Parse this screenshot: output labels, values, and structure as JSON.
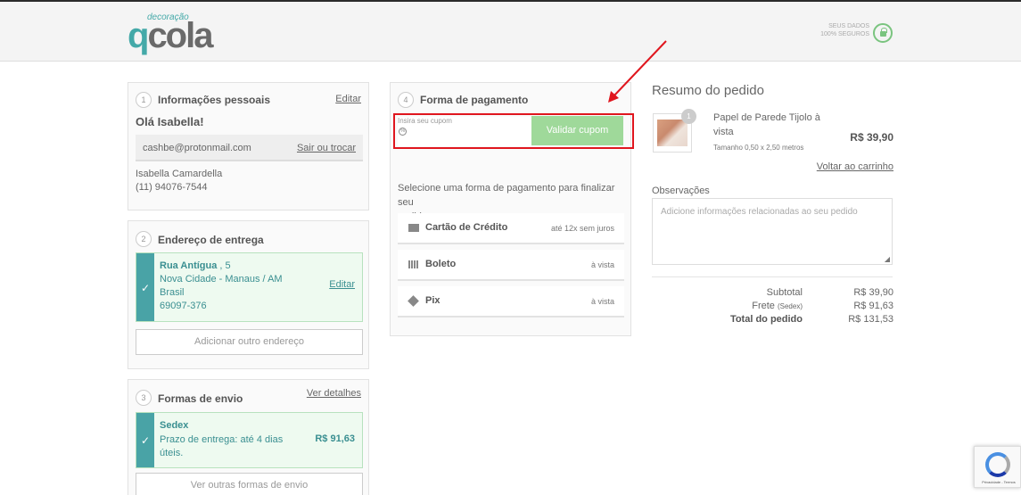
{
  "header": {
    "logo_small": "decoração",
    "logo_q": "q",
    "logo_rest": "cola",
    "secure_line1": "SEUS DADOS",
    "secure_line2": "100% SEGUROS"
  },
  "personal": {
    "step": "1",
    "title": "Informações pessoais",
    "edit": "Editar",
    "greeting": "Olá Isabella!",
    "email": "cashbe@protonmail.com",
    "logout": "Sair ou trocar",
    "name": "Isabella Camardella",
    "phone": "(11) 94076-7544"
  },
  "address": {
    "step": "2",
    "title": "Endereço de entrega",
    "street": "Rua Antígua",
    "number": " , 5",
    "city": "Nova Cidade - Manaus / AM",
    "country": "Brasil",
    "zip": "69097-376",
    "edit": "Editar",
    "add_button": "Adicionar outro endereço"
  },
  "shipping": {
    "step": "3",
    "title": "Formas de envio",
    "details": "Ver detalhes",
    "method": "Sedex",
    "deadline_line1": "Prazo de entrega: até 4 dias",
    "deadline_line2": "úteis.",
    "price": "R$ 91,63",
    "other_button": "Ver outras formas de envio"
  },
  "payment": {
    "step": "4",
    "title": "Forma de pagamento",
    "coupon_placeholder": "Insira seu cupom",
    "coupon_button": "Validar cupom",
    "instructions_line1": "Selecione uma forma de pagamento para finalizar seu",
    "instructions_line2": "pedido:",
    "methods": [
      {
        "label": "Cartão de Crédito",
        "note": "até 12x sem juros"
      },
      {
        "label": "Boleto",
        "note": "à vista"
      },
      {
        "label": "Pix",
        "note": "à vista"
      }
    ]
  },
  "summary": {
    "title": "Resumo do pedido",
    "qty": "1",
    "product_line1": "Papel de Parede Tijolo à",
    "product_line2": "vista",
    "product_size": "Tamanho 0,50 x 2,50 metros",
    "product_price": "R$ 39,90",
    "back_to_cart": "Voltar ao carrinho",
    "notes_label": "Observações",
    "notes_placeholder": "Adicione informações relacionadas ao seu pedido",
    "subtotal_label": "Subtotal",
    "subtotal_value": "R$ 39,90",
    "shipping_label": "Frete",
    "shipping_method": "(Sedex)",
    "shipping_value": "R$ 91,63",
    "total_label": "Total do pedido",
    "total_value": "R$ 131,53"
  },
  "recaptcha": {
    "text": "Privacidade - Termos"
  },
  "colors": {
    "accent": "#49a3a6",
    "coupon_button": "#9fd99a",
    "highlight": "#e0161e"
  }
}
